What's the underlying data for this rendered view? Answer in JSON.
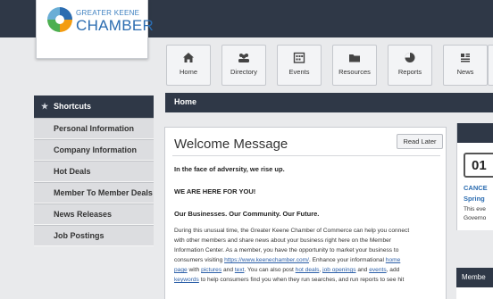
{
  "logo": {
    "line1": "GREATER KEENE",
    "line2": "CHAMBER"
  },
  "toolbar": {
    "buttons": [
      {
        "label": "Home",
        "icon": "home-icon"
      },
      {
        "label": "Directory",
        "icon": "people-icon"
      },
      {
        "label": "Events",
        "icon": "calendar-icon"
      },
      {
        "label": "Resources",
        "icon": "folder-icon"
      },
      {
        "label": "Reports",
        "icon": "pie-chart-icon"
      },
      {
        "label": "News",
        "icon": "news-icon"
      }
    ]
  },
  "breadcrumb": {
    "current": "Home"
  },
  "sidebar": {
    "title": "Shortcuts",
    "items": [
      {
        "label": "Personal Information"
      },
      {
        "label": "Company Information"
      },
      {
        "label": "Hot Deals"
      },
      {
        "label": "Member To Member Deals"
      },
      {
        "label": "News Releases"
      },
      {
        "label": "Job Postings"
      }
    ]
  },
  "welcome": {
    "title": "Welcome Message",
    "read_later": "Read Later",
    "line1": "In the face of adversity, we rise up.",
    "line2": "WE ARE HERE FOR YOU!",
    "line3": "Our Businesses. Our Community. Our Future.",
    "body": {
      "p1": "During this unusual time, the Greater Keene Chamber of Commerce can help you connect",
      "p2": "with other members and share news about your business right here on the Member",
      "p3": "Information Center.  As a member, you have the opportunity to market your business to",
      "p4a": "consumers visiting ",
      "p4_link": "https://www.keenechamber.com/",
      "p4b": ".  Enhance your informational ",
      "p4_link2": "home",
      "p5_link1": "page",
      "p5a": " with ",
      "p5_link2": "pictures",
      "p5b": " and ",
      "p5_link3": "text",
      "p5c": ".  You can also post ",
      "p5_link4": "hot deals",
      "p5d": ", ",
      "p5_link5": "job openings",
      "p5e": " and ",
      "p5_link6": "events",
      "p5f": ", add",
      "p6_link1": "keywords",
      "p6a": " to help consumers find you when they run searches, and run reports to see hit"
    }
  },
  "events": {
    "date": "01",
    "title1": "CANCE",
    "title2": "Spring",
    "text1": "This eve",
    "text2": "Governo"
  },
  "member_panel": {
    "title": "Membe"
  },
  "colors": {
    "navy": "#2f3847",
    "link": "#2b6cb0"
  }
}
